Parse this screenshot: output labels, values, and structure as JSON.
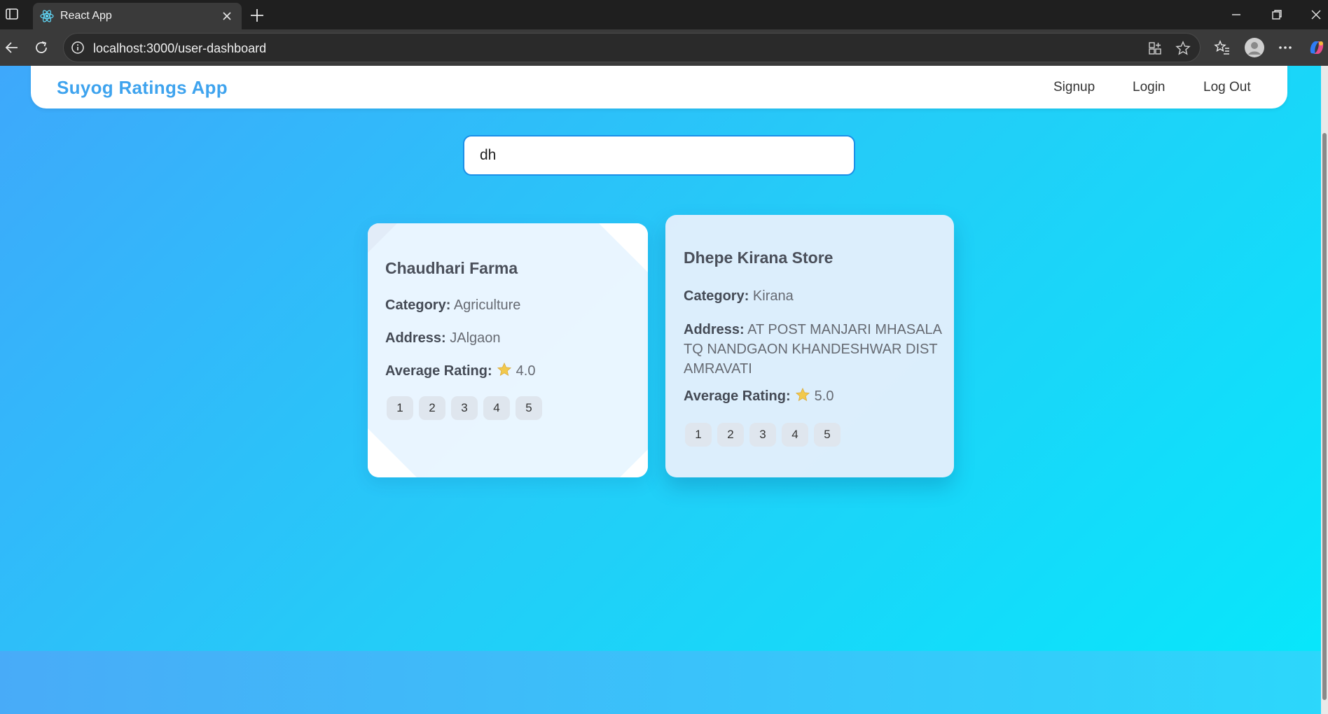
{
  "browser": {
    "tab_title": "React App",
    "url": "localhost:3000/user-dashboard"
  },
  "navbar": {
    "brand": "Suyog Ratings App",
    "links": [
      "Signup",
      "Login",
      "Log Out"
    ]
  },
  "search": {
    "value": "dh"
  },
  "stores": [
    {
      "name": "Chaudhari Farma",
      "category_label": "Category:",
      "category": "Agriculture",
      "address_label": "Address:",
      "address": "JAlgaon",
      "rating_label": "Average Rating:",
      "rating": "4.0",
      "rating_buttons": [
        "1",
        "2",
        "3",
        "4",
        "5"
      ]
    },
    {
      "name": "Dhepe Kirana Store",
      "category_label": "Category:",
      "category": "Kirana",
      "address_label": "Address:",
      "address": "AT POST MANJARI MHASALA TQ NANDGAON KHANDESHWAR DIST AMRAVATI",
      "rating_label": "Average Rating:",
      "rating": "5.0",
      "rating_buttons": [
        "1",
        "2",
        "3",
        "4",
        "5"
      ]
    }
  ],
  "colors": {
    "brand": "#3ea3ee",
    "search_border": "#1b8fe8",
    "star": "#f2c94c"
  }
}
